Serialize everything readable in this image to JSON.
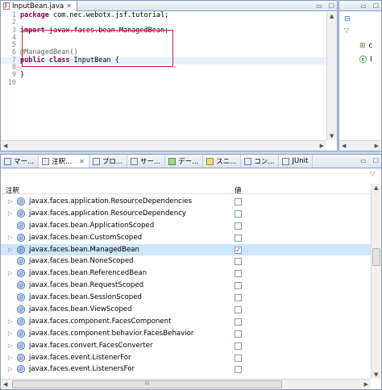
{
  "editor": {
    "tab_label": "InputBean.java",
    "tab_close": "✕",
    "lines": [
      {
        "n": "1",
        "parts": [
          {
            "t": "package",
            "c": "kw"
          },
          {
            "t": " com.nec.webotx.jsf.tutorial;",
            "c": ""
          }
        ]
      },
      {
        "n": "2",
        "parts": []
      },
      {
        "n": "3",
        "parts": [
          {
            "t": "import",
            "c": "kw"
          },
          {
            "t": " javax.faces.bean.ManagedBean;",
            "c": ""
          }
        ]
      },
      {
        "n": "4",
        "parts": []
      },
      {
        "n": "5",
        "parts": []
      },
      {
        "n": "6",
        "parts": [
          {
            "t": "@ManagedBean()",
            "c": "ann"
          }
        ]
      },
      {
        "n": "7",
        "parts": [
          {
            "t": "public",
            "c": "kw"
          },
          {
            "t": " ",
            "c": ""
          },
          {
            "t": "class",
            "c": "kw"
          },
          {
            "t": " InputBean {",
            "c": ""
          }
        ]
      },
      {
        "n": "8",
        "parts": []
      },
      {
        "n": "9",
        "parts": [
          {
            "t": "}",
            "c": ""
          }
        ]
      },
      {
        "n": "10",
        "parts": []
      }
    ]
  },
  "outline": {
    "item1": "c",
    "item2": "I"
  },
  "bottom_tabs": [
    {
      "label": "マー...",
      "icon": "markers-icon",
      "active": false
    },
    {
      "label": "注釈...",
      "icon": "annotations-icon",
      "active": true,
      "close": "✕"
    },
    {
      "label": "プロ...",
      "icon": "properties-icon",
      "active": false
    },
    {
      "label": "サー...",
      "icon": "servers-icon",
      "active": false
    },
    {
      "label": "デー...",
      "icon": "data-icon",
      "active": false
    },
    {
      "label": "スニ...",
      "icon": "snippets-icon",
      "active": false
    },
    {
      "label": "コン...",
      "icon": "console-icon",
      "active": false
    },
    {
      "label": "JUnit",
      "icon": "junit-icon",
      "active": false
    }
  ],
  "table": {
    "col_annotation": "注釈",
    "col_value": "値",
    "rows": [
      {
        "name": "javax.faces.application.ResourceDependencies",
        "expandable": true,
        "checked": false,
        "selected": false
      },
      {
        "name": "javax.faces.application.ResourceDependency",
        "expandable": true,
        "checked": false,
        "selected": false
      },
      {
        "name": "javax.faces.bean.ApplicationScoped",
        "expandable": false,
        "checked": false,
        "selected": false
      },
      {
        "name": "javax.faces.bean.CustomScoped",
        "expandable": true,
        "checked": false,
        "selected": false
      },
      {
        "name": "javax.faces.bean.ManagedBean",
        "expandable": true,
        "checked": true,
        "selected": true
      },
      {
        "name": "javax.faces.bean.NoneScoped",
        "expandable": false,
        "checked": false,
        "selected": false
      },
      {
        "name": "javax.faces.bean.ReferencedBean",
        "expandable": true,
        "checked": false,
        "selected": false
      },
      {
        "name": "javax.faces.bean.RequestScoped",
        "expandable": false,
        "checked": false,
        "selected": false
      },
      {
        "name": "javax.faces.bean.SessionScoped",
        "expandable": false,
        "checked": false,
        "selected": false
      },
      {
        "name": "javax.faces.bean.ViewScoped",
        "expandable": false,
        "checked": false,
        "selected": false
      },
      {
        "name": "javax.faces.component.FacesComponent",
        "expandable": true,
        "checked": false,
        "selected": false
      },
      {
        "name": "javax.faces.component.behavior.FacesBehavior",
        "expandable": true,
        "checked": false,
        "selected": false
      },
      {
        "name": "javax.faces.convert.FacesConverter",
        "expandable": true,
        "checked": false,
        "selected": false
      },
      {
        "name": "javax.faces.event.ListenerFor",
        "expandable": true,
        "checked": false,
        "selected": false
      },
      {
        "name": "javax.faces.event.ListenersFor",
        "expandable": true,
        "checked": false,
        "selected": false
      }
    ]
  },
  "scroll": {
    "hscroll_grip": "III"
  }
}
